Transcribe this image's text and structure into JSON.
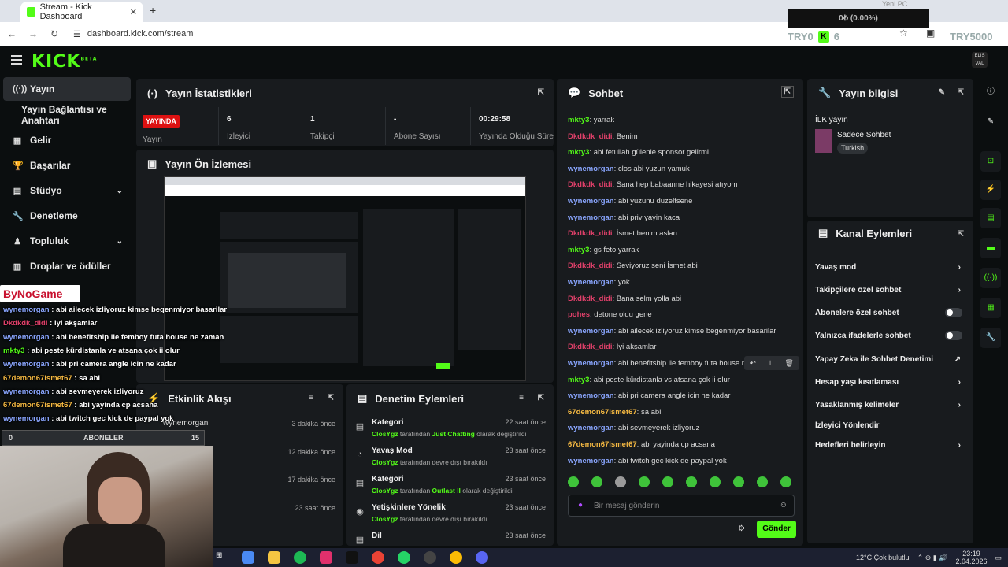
{
  "browser": {
    "tab_title": "Stream - Kick Dashboard",
    "url": "dashboard.kick.com/stream",
    "ticker_top": "Yeni PC",
    "ticker_value": "0₺ (0.00%)",
    "tryo_left": "TRY0",
    "tryo_count": "6",
    "tryo_right": "TRY5000"
  },
  "kick": {
    "logo": "KICK",
    "logo_sup": "BETA",
    "avatar_text": "ELIS VAL"
  },
  "sidebar": {
    "items": [
      {
        "label": "Yayın",
        "icon": "broadcast-icon"
      },
      {
        "label": "Yayın Bağlantısı ve Anahtarı"
      },
      {
        "label": "Gelir",
        "icon": "income-icon"
      },
      {
        "label": "Başarılar",
        "icon": "trophy-icon"
      },
      {
        "label": "Stüdyo",
        "icon": "studio-icon"
      },
      {
        "label": "Denetleme",
        "icon": "wrench-icon"
      },
      {
        "label": "Topluluk",
        "icon": "community-icon"
      },
      {
        "label": "Droplar ve ödüller",
        "icon": "drops-icon"
      }
    ]
  },
  "stats": {
    "title": "Yayın İstatistikleri",
    "live_badge": "YAYINDA",
    "live_label": "Yayın",
    "items": [
      {
        "value": "6",
        "label": "İzleyici"
      },
      {
        "value": "1",
        "label": "Takipçi"
      },
      {
        "value": "-",
        "label": "Abone Sayısı"
      },
      {
        "value": "00:29:58",
        "label": "Yayında Olduğu Süre"
      }
    ]
  },
  "preview": {
    "title": "Yayın Ön İzlemesi"
  },
  "chat": {
    "title": "Sohbet",
    "messages": [
      {
        "user": "mkty3",
        "text": ": yarrak",
        "color": "#53fc18"
      },
      {
        "user": "Dkdkdk_didi",
        "text": ": Benim",
        "color": "#e0406a"
      },
      {
        "user": "mkty3",
        "text": ": abi fetullah gülenle sponsor gelirmi",
        "color": "#53fc18"
      },
      {
        "user": "wynemorgan",
        "text": ": clos abi yuzun yamuk",
        "color": "#8aa6ff"
      },
      {
        "user": "Dkdkdk_didi",
        "text": ": Sana hep babaanne hikayesi atıyom",
        "color": "#e0406a"
      },
      {
        "user": "wynemorgan",
        "text": ": abi yuzunu duzeltsene",
        "color": "#8aa6ff"
      },
      {
        "user": "wynemorgan",
        "text": ": abi priv yayin kaca",
        "color": "#8aa6ff"
      },
      {
        "user": "Dkdkdk_didi",
        "text": ": İsmet benim aslan",
        "color": "#e0406a"
      },
      {
        "user": "mkty3",
        "text": ": gs feto yarrak",
        "color": "#53fc18"
      },
      {
        "user": "Dkdkdk_didi",
        "text": ": Seviyoruz seni İsmet abi",
        "color": "#e0406a"
      },
      {
        "user": "wynemorgan",
        "text": ": yok",
        "color": "#8aa6ff"
      },
      {
        "user": "Dkdkdk_didi",
        "text": ": Bana selm yolla abi",
        "color": "#e0406a"
      },
      {
        "user": "pohes",
        "text": ": detone oldu gene",
        "color": "#e0406a"
      },
      {
        "user": "wynemorgan",
        "text": ": abi ailecek izliyoruz kimse begenmiyor basarilar",
        "color": "#8aa6ff"
      },
      {
        "user": "Dkdkdk_didi",
        "text": ": İyi akşamlar",
        "color": "#e0406a"
      },
      {
        "user": "wynemorgan",
        "text": ": abi benefitship ile femboy futa house ne",
        "color": "#8aa6ff"
      },
      {
        "user": "mkty3",
        "text": ": abi peste kürdistanla vs atsana çok ii olur",
        "color": "#53fc18"
      },
      {
        "user": "wynemorgan",
        "text": ": abi pri camera angle icin ne kadar",
        "color": "#8aa6ff"
      },
      {
        "user": "67demon67ismet67",
        "text": ": sa abi",
        "color": "#f5b942"
      },
      {
        "user": "wynemorgan",
        "text": ": abi sevmeyerek izliyoruz",
        "color": "#8aa6ff"
      },
      {
        "user": "67demon67ismet67",
        "text": ": abi yayinda cp acsana",
        "color": "#f5b942"
      },
      {
        "user": "wynemorgan",
        "text": ": abi twitch gec kick de paypal yok",
        "color": "#8aa6ff"
      }
    ],
    "input_placeholder": "Bir mesaj gönderin",
    "send_label": "Gönder"
  },
  "stream_info": {
    "title": "Yayın bilgisi",
    "stream_title": "İLK yayın",
    "category": "Sadece Sohbet",
    "language": "Turkish"
  },
  "channel_actions": {
    "title": "Kanal Eylemleri",
    "items": [
      {
        "label": "Yavaş mod",
        "control": "arrow"
      },
      {
        "label": "Takipçilere özel sohbet",
        "control": "arrow"
      },
      {
        "label": "Abonelere özel sohbet",
        "control": "toggle"
      },
      {
        "label": "Yalnızca ifadelerle sohbet",
        "control": "toggle"
      },
      {
        "label": "Yapay Zeka ile Sohbet Denetimi",
        "control": "link"
      },
      {
        "label": "Hesap yaşı kısıtlaması",
        "control": "arrow"
      },
      {
        "label": "Yasaklanmış kelimeler",
        "control": "arrow"
      },
      {
        "label": "İzleyici Yönlendir",
        "control": "none"
      },
      {
        "label": "Hedefleri belirleyin",
        "control": "arrow"
      }
    ]
  },
  "activity": {
    "title": "Etkinlik Akışı",
    "rows": [
      {
        "user": "wynemorgan",
        "time": "3 dakika önce"
      },
      {
        "user": "",
        "time": "12 dakika önce"
      },
      {
        "user": "",
        "time": "17 dakika önce"
      },
      {
        "user": "",
        "time": "23 saat önce"
      }
    ]
  },
  "moderation": {
    "title": "Denetim Eylemleri",
    "rows": [
      {
        "icon": "category-icon",
        "title": "Kategori",
        "user": "ClosYgz",
        "mid": " tarafından ",
        "value": "Just Chatting",
        "tail": " olarak değiştirildi",
        "time": "22 saat önce"
      },
      {
        "icon": "slow-mode-icon",
        "title": "Yavaş Mod",
        "user": "ClosYgz",
        "mid": " tarafından devre dışı bırakıldı",
        "value": "",
        "tail": "",
        "time": "23 saat önce"
      },
      {
        "icon": "category-icon",
        "title": "Kategori",
        "user": "ClosYgz",
        "mid": " tarafından ",
        "value": "Outlast II",
        "tail": " olarak değiştirildi",
        "time": "23 saat önce"
      },
      {
        "icon": "eye-icon",
        "title": "Yetişkinlere Yönelik",
        "user": "ClosYgz",
        "mid": " tarafından devre dışı bırakıldı",
        "value": "",
        "tail": "",
        "time": "23 saat önce"
      },
      {
        "icon": "language-icon",
        "title": "Dil",
        "user": "",
        "mid": "",
        "value": "",
        "tail": "",
        "time": "23 saat önce"
      }
    ]
  },
  "overlay": {
    "brand": "ByNoGame",
    "subs_label": "ABONELER",
    "subs_left": "0",
    "subs_count": "15",
    "lines": [
      {
        "user": "wynemorgan",
        "text": " : abi ailecek izliyoruz kimse begenmiyor basarilar",
        "color": "#8aa6ff"
      },
      {
        "user": "Dkdkdk_didi",
        "text": " : iyi akşamlar",
        "color": "#e0406a"
      },
      {
        "user": "wynemorgan",
        "text": " : abi benefitship ile femboy futa house ne zaman",
        "color": "#8aa6ff"
      },
      {
        "user": "mkty3",
        "text": " : abi peste kürdistanla ve atsana çok ii olur",
        "color": "#53fc18"
      },
      {
        "user": "wynemorgan",
        "text": " : abi pri camera angle icin ne kadar",
        "color": "#8aa6ff"
      },
      {
        "user": "67demon67ismet67",
        "text": " : sa abi",
        "color": "#f5b942"
      },
      {
        "user": "wynemorgan",
        "text": " : abi sevmeyerek izliyoruz",
        "color": "#8aa6ff"
      },
      {
        "user": "67demon67ismet67",
        "text": " : abi yayinda cp acsana",
        "color": "#f5b942"
      },
      {
        "user": "wynemorgan",
        "text": " : abi twitch gec kick de paypal yok",
        "color": "#8aa6ff"
      }
    ]
  },
  "taskbar": {
    "weather": "12°C  Çok bulutlu",
    "time": "23:19",
    "date": "2.04.2026"
  },
  "colors": {
    "accent": "#53fc18",
    "panel": "#181b1e",
    "background": "#0b0e0f",
    "live": "#dd1111"
  }
}
